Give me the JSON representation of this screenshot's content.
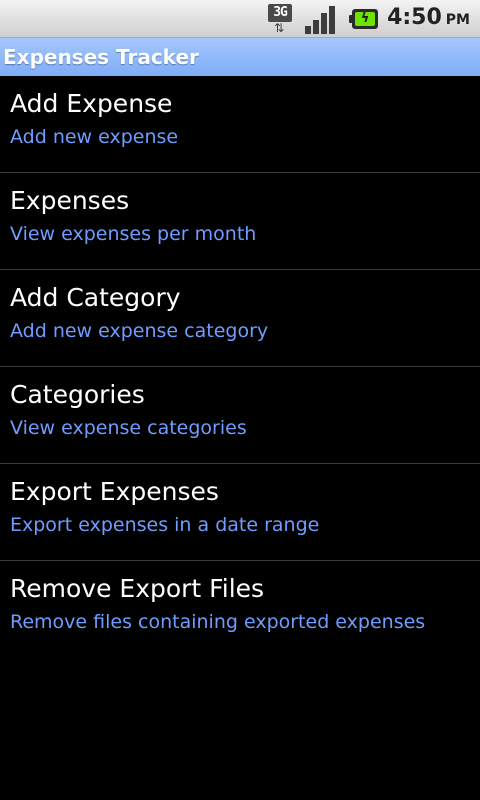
{
  "status_bar": {
    "network_label": "3G",
    "network_arrows": "⇅",
    "time": "4:50",
    "am_pm": "PM",
    "signal_level": 1.0,
    "battery_level": 1.0
  },
  "app": {
    "title": "Expenses Tracker"
  },
  "menu": {
    "items": [
      {
        "title": "Add Expense",
        "subtitle": "Add new expense"
      },
      {
        "title": "Expenses",
        "subtitle": "View expenses per month"
      },
      {
        "title": "Add Category",
        "subtitle": "Add new expense category"
      },
      {
        "title": "Categories",
        "subtitle": "View expense categories"
      },
      {
        "title": "Export Expenses",
        "subtitle": "Export expenses in a date range"
      },
      {
        "title": "Remove Export Files",
        "subtitle": "Remove files containing exported expenses"
      }
    ]
  },
  "colors": {
    "background": "#000000",
    "title_bar": "#7fadf7",
    "subtitle_text": "#6f9cff",
    "battery_fill": "#6ee200"
  },
  "icons": {
    "network": "network-3g-icon",
    "signal": "signal-strength-icon",
    "battery": "battery-charging-icon"
  }
}
